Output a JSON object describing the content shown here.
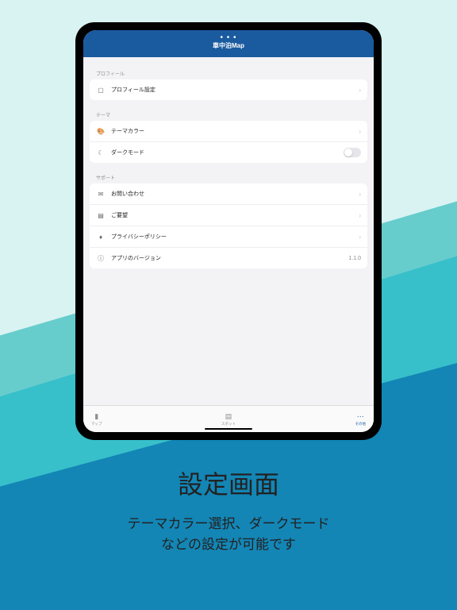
{
  "navbar": {
    "title": "車中泊Map",
    "dots": "• • •"
  },
  "sections": {
    "profile": {
      "header": "プロフィール",
      "item_label": "プロフィール設定"
    },
    "theme": {
      "header": "テーマ",
      "color_label": "テーマカラー",
      "dark_label": "ダークモード",
      "dark_on": false
    },
    "support": {
      "header": "サポート",
      "contact_label": "お問い合わせ",
      "request_label": "ご要望",
      "privacy_label": "プライバシーポリシー",
      "version_label": "アプリのバージョン",
      "version_value": "1.1.0"
    }
  },
  "tabbar": {
    "map_label": "マップ",
    "spot_label": "スポット",
    "other_label": "その他"
  },
  "promo": {
    "title": "設定画面",
    "line1": "テーマカラー選択、ダークモード",
    "line2": "などの設定が可能です"
  }
}
